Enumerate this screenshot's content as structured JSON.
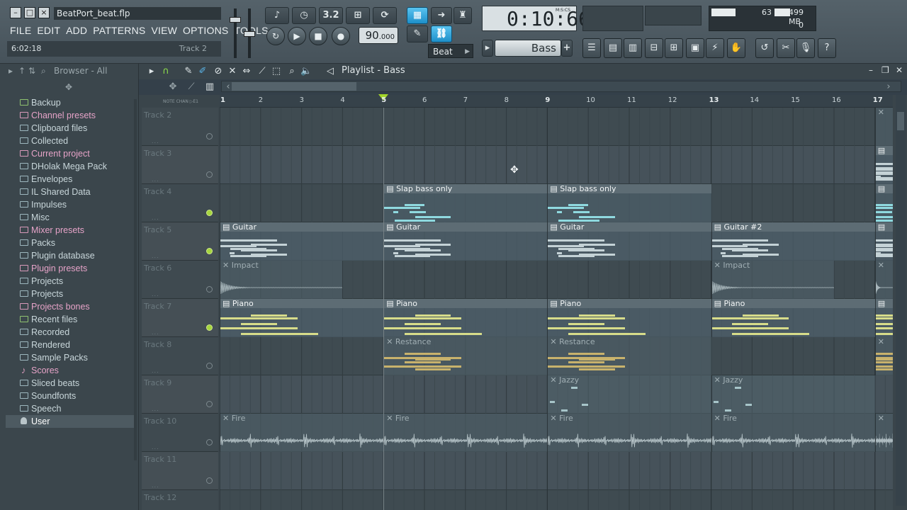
{
  "window": {
    "title": "BeatPort_beat.flp"
  },
  "menu": [
    "FILE",
    "EDIT",
    "ADD",
    "PATTERNS",
    "VIEW",
    "OPTIONS",
    "TOOLS",
    "?"
  ],
  "hint": {
    "time": "6:02:18",
    "track": "Track 2"
  },
  "transport": {
    "tempo_int": "90",
    "tempo_dec": ".000",
    "pattern_mode": "Beat",
    "step_label": "3.2"
  },
  "time_display": {
    "value": "0:10:66",
    "unit": "M:S:CS"
  },
  "monitor": {
    "cpu": "63",
    "cpu_fill": 0.63,
    "memory": "499 MB",
    "polyphony": "0"
  },
  "pattern_selector": "Bass",
  "browser": {
    "title": "Browser - All",
    "items": [
      {
        "label": "Backup",
        "style": "green",
        "icon": "folder-icon"
      },
      {
        "label": "Channel presets",
        "style": "hl",
        "icon": "folder-icon"
      },
      {
        "label": "Clipboard files",
        "style": "",
        "icon": "folder-icon"
      },
      {
        "label": "Collected",
        "style": "",
        "icon": "folder-icon"
      },
      {
        "label": "Current project",
        "style": "hl",
        "icon": "project-icon"
      },
      {
        "label": "DHolak Mega Pack",
        "style": "",
        "icon": "folder-icon"
      },
      {
        "label": "Envelopes",
        "style": "",
        "icon": "folder-icon"
      },
      {
        "label": "IL Shared Data",
        "style": "",
        "icon": "folder-icon"
      },
      {
        "label": "Impulses",
        "style": "",
        "icon": "folder-icon"
      },
      {
        "label": "Misc",
        "style": "",
        "icon": "folder-icon"
      },
      {
        "label": "Mixer presets",
        "style": "hl",
        "icon": "folder-icon"
      },
      {
        "label": "Packs",
        "style": "",
        "icon": "folder-icon"
      },
      {
        "label": "Plugin database",
        "style": "",
        "icon": "folder-icon"
      },
      {
        "label": "Plugin presets",
        "style": "hl",
        "icon": "folder-icon"
      },
      {
        "label": "Projects",
        "style": "",
        "icon": "folder-icon"
      },
      {
        "label": "Projects",
        "style": "",
        "icon": "folder-icon"
      },
      {
        "label": "Projects bones",
        "style": "hl",
        "icon": "folder-icon"
      },
      {
        "label": "Recent files",
        "style": "green",
        "icon": "folder-icon"
      },
      {
        "label": "Recorded",
        "style": "",
        "icon": "folder-icon"
      },
      {
        "label": "Rendered",
        "style": "",
        "icon": "folder-icon"
      },
      {
        "label": "Sample Packs",
        "style": "",
        "icon": "folder-icon"
      },
      {
        "label": "Scores",
        "style": "hl",
        "icon": "note-icon"
      },
      {
        "label": "Sliced beats",
        "style": "",
        "icon": "folder-icon"
      },
      {
        "label": "Soundfonts",
        "style": "",
        "icon": "folder-icon"
      },
      {
        "label": "Speech",
        "style": "",
        "icon": "folder-icon"
      },
      {
        "label": "User",
        "style": "sel",
        "icon": "user-icon"
      }
    ]
  },
  "playlist": {
    "title": "Playlist - Bass",
    "ruler_bars": [
      "1",
      "2",
      "3",
      "4",
      "5",
      "6",
      "7",
      "8",
      "9",
      "10",
      "11",
      "12",
      "13",
      "14",
      "15",
      "16",
      "17"
    ],
    "note_labels": "NOTE  CHAN  ▷E1",
    "tracks": [
      "Track 2",
      "Track 3",
      "Track 4",
      "Track 5",
      "Track 6",
      "Track 7",
      "Track 8",
      "Track 9",
      "Track 10",
      "Track 11",
      "Track 12"
    ],
    "active_tracks": [
      2,
      3,
      5
    ],
    "clips": [
      {
        "track": 2,
        "bar": 5,
        "bars": 4,
        "name": "Slap bass only",
        "kind": "pattern",
        "notes": "cyan-bass"
      },
      {
        "track": 2,
        "bar": 9,
        "bars": 4,
        "name": "Slap bass only",
        "kind": "pattern",
        "notes": "cyan-bass"
      },
      {
        "track": 2,
        "bar": 17,
        "bars": 0.5,
        "name": "",
        "kind": "pattern",
        "notes": "cyan-bass"
      },
      {
        "track": 3,
        "bar": 1,
        "bars": 4,
        "name": "Guitar",
        "kind": "pattern",
        "notes": "grey-guitar"
      },
      {
        "track": 3,
        "bar": 5,
        "bars": 4,
        "name": "Guitar",
        "kind": "pattern",
        "notes": "grey-guitar"
      },
      {
        "track": 3,
        "bar": 9,
        "bars": 4,
        "name": "Guitar",
        "kind": "pattern",
        "notes": "grey-guitar"
      },
      {
        "track": 3,
        "bar": 13,
        "bars": 4,
        "name": "Guitar #2",
        "kind": "pattern",
        "notes": "grey-guitar"
      },
      {
        "track": 3,
        "bar": 17,
        "bars": 0.5,
        "name": "",
        "kind": "pattern",
        "notes": "grey-guitar"
      },
      {
        "track": 4,
        "bar": 1,
        "bars": 3,
        "name": "Impact",
        "kind": "audio",
        "notes": "wave-impact"
      },
      {
        "track": 4,
        "bar": 13,
        "bars": 3,
        "name": "Impact",
        "kind": "audio",
        "notes": "wave-impact"
      },
      {
        "track": 4,
        "bar": 17,
        "bars": 0.5,
        "name": "",
        "kind": "audio",
        "notes": "wave-impact"
      },
      {
        "track": 5,
        "bar": 1,
        "bars": 4,
        "name": "Piano",
        "kind": "pattern",
        "notes": "yellow-piano"
      },
      {
        "track": 5,
        "bar": 5,
        "bars": 4,
        "name": "Piano",
        "kind": "pattern",
        "notes": "yellow-piano"
      },
      {
        "track": 5,
        "bar": 9,
        "bars": 4,
        "name": "Piano",
        "kind": "pattern",
        "notes": "yellow-piano"
      },
      {
        "track": 5,
        "bar": 13,
        "bars": 4,
        "name": "Piano",
        "kind": "pattern",
        "notes": "yellow-piano"
      },
      {
        "track": 5,
        "bar": 17,
        "bars": 0.5,
        "name": "",
        "kind": "pattern",
        "notes": "yellow-piano"
      },
      {
        "track": 6,
        "bar": 5,
        "bars": 4,
        "name": "Restance",
        "kind": "audio",
        "notes": "gold-restance"
      },
      {
        "track": 6,
        "bar": 9,
        "bars": 4,
        "name": "Restance",
        "kind": "audio",
        "notes": "gold-restance"
      },
      {
        "track": 6,
        "bar": 17,
        "bars": 0.5,
        "name": "",
        "kind": "audio",
        "notes": "gold-restance"
      },
      {
        "track": 7,
        "bar": 9,
        "bars": 4,
        "name": "Jazzy",
        "kind": "audio",
        "notes": "pale-jazzy"
      },
      {
        "track": 7,
        "bar": 13,
        "bars": 4,
        "name": "Jazzy",
        "kind": "audio",
        "notes": "pale-jazzy"
      },
      {
        "track": 8,
        "bar": 1,
        "bars": 4,
        "name": "Fire",
        "kind": "audio",
        "notes": "wave-fire"
      },
      {
        "track": 8,
        "bar": 5,
        "bars": 4,
        "name": "Fire",
        "kind": "audio",
        "notes": "wave-fire"
      },
      {
        "track": 8,
        "bar": 9,
        "bars": 4,
        "name": "Fire",
        "kind": "audio",
        "notes": "wave-fire"
      },
      {
        "track": 8,
        "bar": 13,
        "bars": 4,
        "name": "Fire",
        "kind": "audio",
        "notes": "wave-fire"
      },
      {
        "track": 8,
        "bar": 17,
        "bars": 0.5,
        "name": "",
        "kind": "audio",
        "notes": "wave-fire"
      },
      {
        "track": 0,
        "bar": 17,
        "bars": 0.5,
        "name": "",
        "kind": "audio",
        "notes": ""
      },
      {
        "track": 1,
        "bar": 17,
        "bars": 0.5,
        "name": "",
        "kind": "pattern",
        "notes": "grey-guitar"
      }
    ],
    "song_position_bar": 5
  },
  "colors": {
    "accent_green": "#a4d629",
    "highlight_blue": "#1d8fc9",
    "bass_notes": "#8fd9df",
    "piano_notes": "#d7dc8a"
  }
}
